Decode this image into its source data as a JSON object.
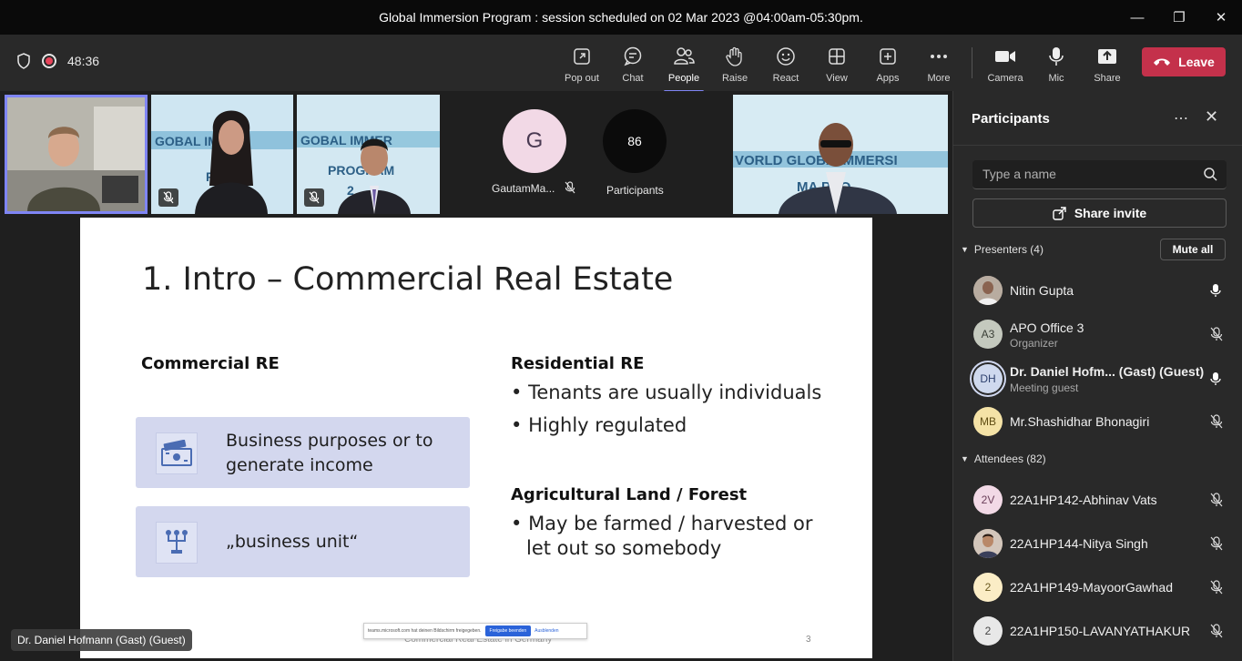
{
  "window": {
    "title": "Global Immersion Program : session scheduled on 02 Mar 2023 @04:00am-05:30pm."
  },
  "meeting": {
    "timer": "48:36"
  },
  "toolbar": {
    "popout": "Pop out",
    "chat": "Chat",
    "people": "People",
    "raise": "Raise",
    "react": "React",
    "view": "View",
    "apps": "Apps",
    "more": "More",
    "camera": "Camera",
    "mic": "Mic",
    "share": "Share",
    "leave": "Leave"
  },
  "gallery": {
    "avatar_initial": "G",
    "avatar_name": "GautamMa...",
    "participant_count": "86",
    "participant_label": "Participants"
  },
  "slide": {
    "title": "1. Intro – Commercial Real Estate",
    "commercial_heading": "Commercial RE",
    "box1_line1": "Business purposes or to",
    "box1_line2": "generate income",
    "box2_text": "„business unit“",
    "residential_heading": "Residential RE",
    "residential_bullets": [
      "Tenants are usually individuals",
      "Highly regulated"
    ],
    "agri_heading": "Agricultural Land / Forest",
    "agri_bullet_line1": "May be farmed / harvested or",
    "agri_bullet_line2": "let out so somebody",
    "footer": "Commercial Real Estate in Germany",
    "page_number": "3",
    "share_notice": "teams.microsoft.com hat deinen Bildschirm freigegeben.",
    "share_stop": "Freigabe beenden",
    "share_hide": "Ausblenden"
  },
  "speaker_tag": "Dr. Daniel Hofmann (Gast) (Guest)",
  "panel": {
    "title": "Participants",
    "search_placeholder": "Type a name",
    "share_invite": "Share invite",
    "presenters_heading": "Presenters (4)",
    "mute_all": "Mute all",
    "attendees_heading": "Attendees (82)",
    "presenters": [
      {
        "name": "Nitin Gupta",
        "role": "",
        "initials": "",
        "mic": "on"
      },
      {
        "name": "APO Office 3",
        "role": "Organizer",
        "initials": "A3",
        "mic": "off"
      },
      {
        "name": "Dr. Daniel Hofm... (Gast) (Guest)",
        "role": "Meeting guest",
        "initials": "DH",
        "mic": "on"
      },
      {
        "name": "Mr.Shashidhar Bhonagiri",
        "role": "",
        "initials": "MB",
        "mic": "off"
      }
    ],
    "attendees": [
      {
        "name": "22A1HP142-Abhinav Vats",
        "initials": "2V",
        "mic": "off"
      },
      {
        "name": "22A1HP144-Nitya Singh",
        "initials": "",
        "mic": "off"
      },
      {
        "name": "22A1HP149-MayoorGawhad",
        "initials": "2",
        "mic": "off"
      },
      {
        "name": "22A1HP150-LAVANYATHAKUR",
        "initials": "2",
        "mic": "off"
      }
    ]
  },
  "colors": {
    "accent": "#7f85f5",
    "leave": "#c4314b",
    "slide_box": "#d3d7ee"
  }
}
